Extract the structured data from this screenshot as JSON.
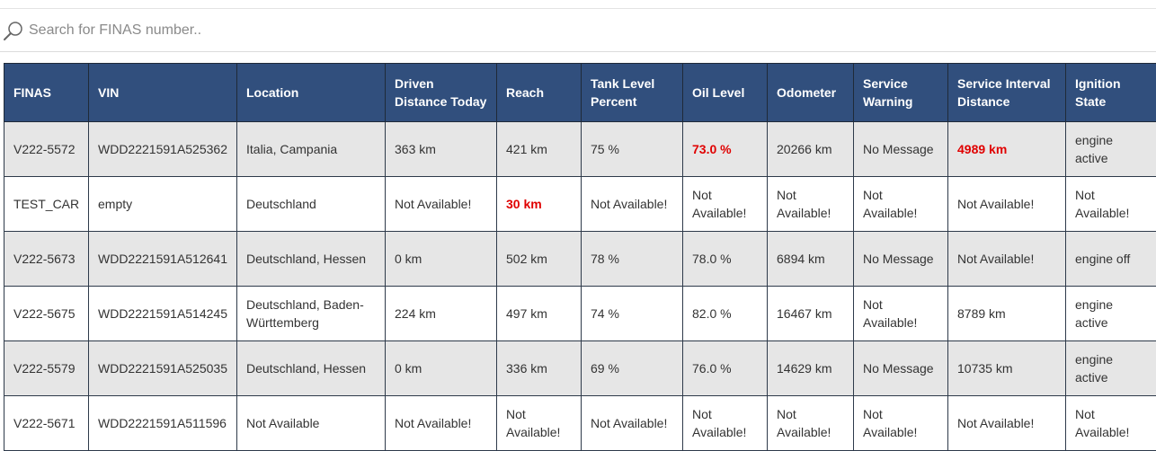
{
  "search": {
    "placeholder": "Search for FINAS number..",
    "icon": "search-icon"
  },
  "table": {
    "headers": [
      "FINAS",
      "VIN",
      "Location",
      "Driven Distance Today",
      "Reach",
      "Tank Level Percent",
      "Oil Level",
      "Odometer",
      "Service Warning",
      "Service Interval Distance",
      "Ignition State"
    ],
    "warning_color": "#e00000",
    "header_color": "#314f7d",
    "rows": [
      {
        "cells": [
          "V222-5572",
          "WDD2221591A525362",
          "Italia, Campania",
          "363 km",
          "421 km",
          "75 %",
          "73.0 %",
          "20266 km",
          "No Message",
          "4989 km",
          "engine active"
        ],
        "warn": [
          6,
          9
        ]
      },
      {
        "cells": [
          "TEST_CAR",
          "empty",
          "Deutschland",
          "Not Available!",
          "30 km",
          "Not Available!",
          "Not Available!",
          "Not Available!",
          "Not Available!",
          "Not Available!",
          "Not Available!"
        ],
        "warn": [
          4
        ]
      },
      {
        "cells": [
          "V222-5673",
          "WDD2221591A512641",
          "Deutschland, Hessen",
          "0 km",
          "502 km",
          "78 %",
          "78.0 %",
          "6894 km",
          "No Message",
          "Not Available!",
          "engine off"
        ],
        "warn": []
      },
      {
        "cells": [
          "V222-5675",
          "WDD2221591A514245",
          "Deutschland, Baden-Württemberg",
          "224 km",
          "497 km",
          "74 %",
          "82.0 %",
          "16467 km",
          "Not Available!",
          "8789 km",
          "engine active"
        ],
        "warn": []
      },
      {
        "cells": [
          "V222-5579",
          "WDD2221591A525035",
          "Deutschland, Hessen",
          "0 km",
          "336 km",
          "69 %",
          "76.0 %",
          "14629 km",
          "No Message",
          "10735 km",
          "engine active"
        ],
        "warn": []
      },
      {
        "cells": [
          "V222-5671",
          "WDD2221591A511596",
          "Not Available",
          "Not Available!",
          "Not Available!",
          "Not Available!",
          "Not Available!",
          "Not Available!",
          "Not Available!",
          "Not Available!",
          "Not Available!"
        ],
        "warn": []
      }
    ]
  }
}
